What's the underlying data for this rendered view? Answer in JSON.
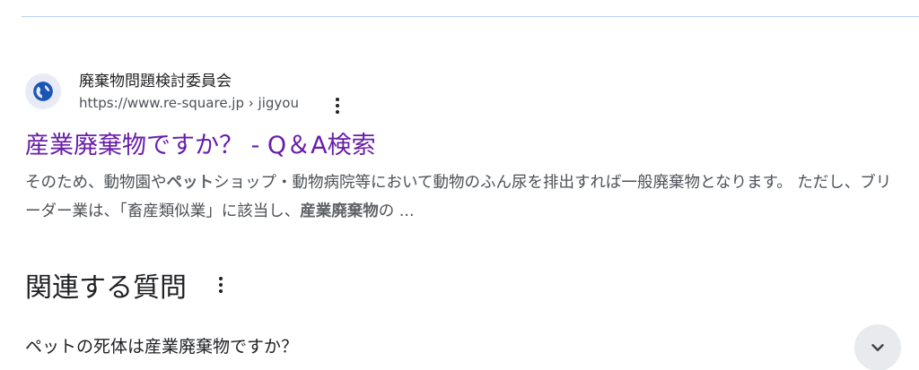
{
  "result": {
    "site_name": "廃棄物問題検討委員会",
    "site_url": "https://www.re-square.jp › jigyou",
    "title": "産業廃棄物ですか？ - Q＆A検索",
    "snippet": {
      "part1": "そのため、動物園や",
      "bold1": "ペット",
      "part2": "ショップ・動物病院等において動物のふん尿を排出すれば一般廃棄物となります。 ただし、ブリーダー業は、「畜産類似業」に該当し、",
      "bold2": "産業廃棄物",
      "part3": "の ..."
    },
    "favicon_icon": "globe-icon",
    "menu_icon": "more-vert-icon"
  },
  "related_questions": {
    "heading": "関連する質問",
    "menu_icon": "more-vert-icon",
    "items": [
      {
        "question": "ペットの死体は産業廃棄物ですか？",
        "icon": "chevron-down-icon"
      }
    ]
  },
  "colors": {
    "link_visited": "#681da8",
    "text_primary": "#202124",
    "text_secondary": "#4d5156",
    "divider": "#bcd0f2",
    "favicon_bg": "#e8eaf6",
    "globe": "#1a56b5",
    "button_bg": "#e8eaed"
  }
}
